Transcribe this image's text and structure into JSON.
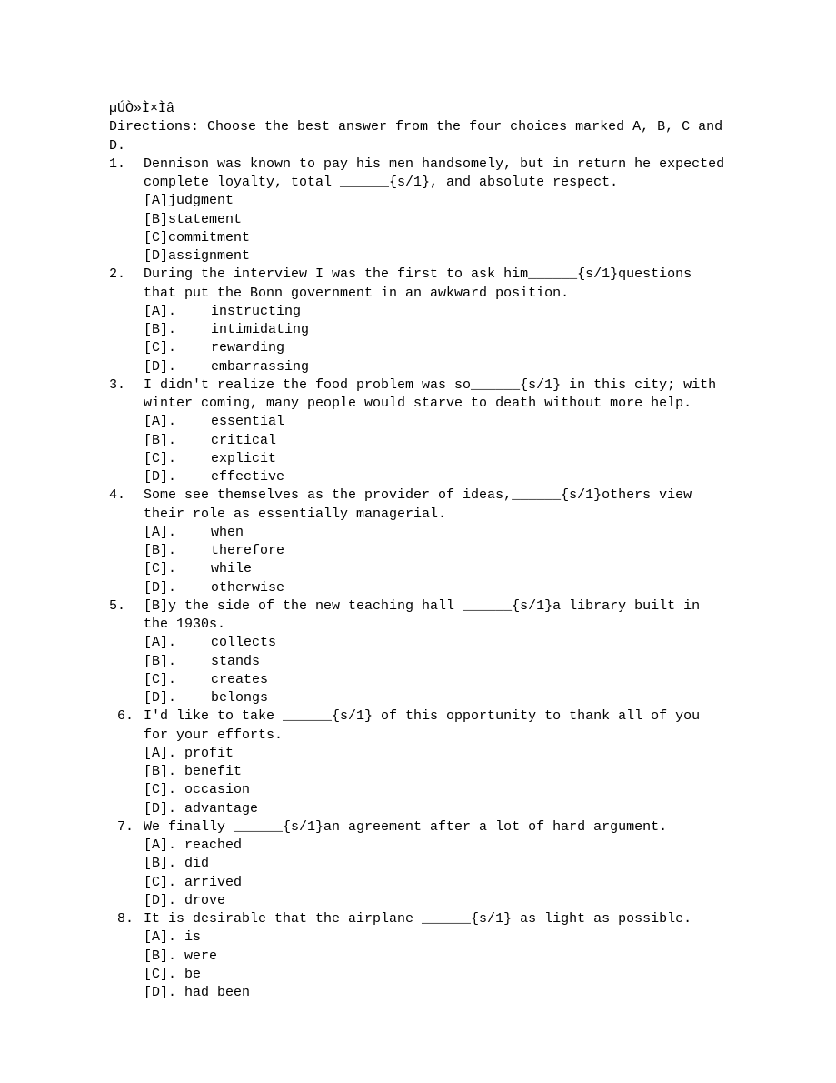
{
  "header": "µÚÒ»Ì×Ìâ",
  "directions": "Directions: Choose the best answer from the four choices marked A, B, C and D.",
  "questions": [
    {
      "num": "1.",
      "text": "Dennison was known to pay his men handsomely, but in return he expected complete loyalty, total ______{s/1}, and absolute respect.",
      "choice_style": "bracket_tight",
      "choices": [
        {
          "key": "[A]",
          "label": "judgment"
        },
        {
          "key": "[B]",
          "label": "statement"
        },
        {
          "key": "[C]",
          "label": "commitment"
        },
        {
          "key": "[D]",
          "label": "assignment"
        }
      ]
    },
    {
      "num": "2.",
      "text": "During the interview I was the first to ask him______{s/1}questions that put the Bonn government in an awkward position.",
      "choice_style": "bracket_dot_pad",
      "choices": [
        {
          "key": "[A].",
          "label": "instructing"
        },
        {
          "key": "[B].",
          "label": "intimidating"
        },
        {
          "key": "[C].",
          "label": "rewarding"
        },
        {
          "key": "[D].",
          "label": "embarrassing"
        }
      ]
    },
    {
      "num": "3.",
      "text": "I didn't realize the food problem was so______{s/1} in this city; with winter coming, many people would starve to death without more help.",
      "choice_style": "bracket_dot_pad",
      "choices": [
        {
          "key": "[A].",
          "label": "essential"
        },
        {
          "key": "[B].",
          "label": "critical"
        },
        {
          "key": "[C].",
          "label": "explicit"
        },
        {
          "key": "[D].",
          "label": "effective"
        }
      ]
    },
    {
      "num": "4.",
      "text": " Some see themselves as the provider of ideas,______{s/1}others view their role as essentially managerial.",
      "choice_style": "bracket_dot_pad",
      "choices": [
        {
          "key": "[A].",
          "label": "when"
        },
        {
          "key": "[B].",
          "label": "therefore"
        },
        {
          "key": "[C].",
          "label": "while"
        },
        {
          "key": "[D].",
          "label": "otherwise"
        }
      ]
    },
    {
      "num": "5.",
      "text": " [B]y the side of the new teaching hall ______{s/1}a library built in the 1930s.",
      "choice_style": "bracket_dot_pad",
      "choices": [
        {
          "key": "[A].",
          "label": "collects"
        },
        {
          "key": "[B].",
          "label": "stands"
        },
        {
          "key": "[C].",
          "label": "creates"
        },
        {
          "key": "[D].",
          "label": "belongs"
        }
      ]
    },
    {
      "num": " 6.",
      "text": "I'd like to take ______{s/1} of this opportunity to thank all of you for your efforts.",
      "choice_style": "bracket_dot_tight",
      "choices": [
        {
          "key": "[A].",
          "label": "profit"
        },
        {
          "key": "[B].",
          "label": "benefit"
        },
        {
          "key": "[C].",
          "label": "occasion"
        },
        {
          "key": "[D].",
          "label": "advantage"
        }
      ]
    },
    {
      "num": " 7.",
      "text": "We finally ______{s/1}an agreement after a lot of hard argument.",
      "choice_style": "bracket_dot_tight",
      "choices": [
        {
          "key": "[A].",
          "label": "reached"
        },
        {
          "key": "[B].",
          "label": "did"
        },
        {
          "key": "[C].",
          "label": "arrived"
        },
        {
          "key": "[D].",
          "label": "drove"
        }
      ]
    },
    {
      "num": " 8.",
      "text": "It is desirable that the airplane ______{s/1} as light as possible.",
      "choice_style": "bracket_dot_tight",
      "choices": [
        {
          "key": "[A].",
          "label": "is"
        },
        {
          "key": "[B].",
          "label": "were"
        },
        {
          "key": "[C].",
          "label": "be"
        },
        {
          "key": "[D].",
          "label": "had been"
        }
      ]
    }
  ]
}
